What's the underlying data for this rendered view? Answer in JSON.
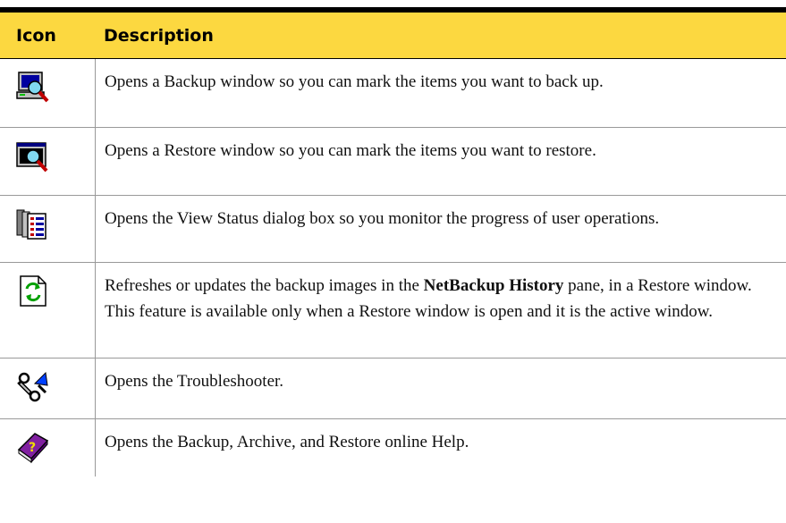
{
  "table": {
    "header": {
      "icon": "Icon",
      "description": "Description"
    },
    "rows": [
      {
        "icon": "backup-icon",
        "description": "Opens a Backup window so you can mark the items you want to back up."
      },
      {
        "icon": "restore-icon",
        "description": "Opens a Restore window so you can mark the items you want to restore."
      },
      {
        "icon": "view-status-icon",
        "description": "Opens the View Status dialog box so you monitor the progress of user operations."
      },
      {
        "icon": "refresh-icon",
        "description_pre": "Refreshes or updates the backup images in the ",
        "description_bold": "NetBackup History",
        "description_post": " pane, in a Restore window. This feature is available only when a Restore window is open and it is the active window."
      },
      {
        "icon": "troubleshooter-icon",
        "description": "Opens the Troubleshooter."
      },
      {
        "icon": "help-icon",
        "description": "Opens the Backup, Archive, and Restore online Help."
      }
    ]
  },
  "colors": {
    "header_bg": "#fcd840",
    "rule": "#000000",
    "divider": "#999999"
  }
}
